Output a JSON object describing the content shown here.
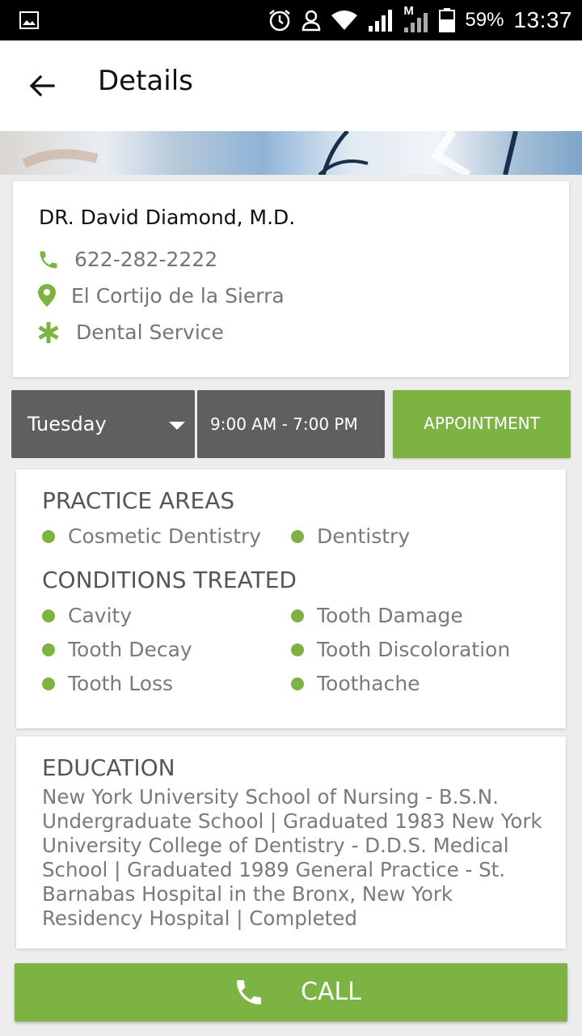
{
  "status_bar": {
    "battery": "59%",
    "time": "13:37",
    "network_label": "M"
  },
  "app_bar": {
    "title": "Details"
  },
  "doctor": {
    "name": "DR. David Diamond, M.D.",
    "phone": "622-282-2222",
    "location": "El Cortijo de la Sierra",
    "service": "Dental Service"
  },
  "schedule": {
    "day": "Tuesday",
    "hours": "9:00 AM - 7:00 PM",
    "appointment_label": "APPOINTMENT"
  },
  "practice": {
    "title": "PRACTICE AREAS",
    "areas": [
      "Cosmetic Dentistry",
      "Dentistry"
    ],
    "conditions_title": "CONDITIONS TREATED",
    "conditions": [
      "Cavity",
      "Tooth Damage",
      "Tooth Decay",
      "Tooth Discoloration",
      "Tooth Loss",
      "Toothache"
    ]
  },
  "education": {
    "title": "EDUCATION",
    "text": "New York University School of Nursing - B.S.N. Undergraduate School | Graduated 1983 New York University College of Dentistry - D.D.S. Medical School | Graduated 1989 General Practice - St. Barnabas Hospital in the Bronx, New York Residency Hospital | Completed"
  },
  "call_label": "CALL",
  "colors": {
    "accent": "#7cb342",
    "dark_button": "#5f5f5f",
    "status_bar": "#000000"
  }
}
